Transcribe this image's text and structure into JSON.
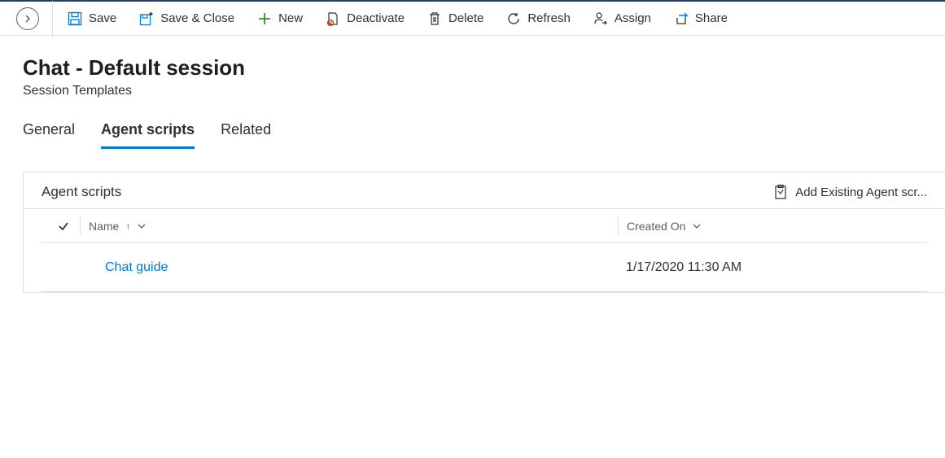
{
  "toolbar": {
    "save_label": "Save",
    "save_close_label": "Save & Close",
    "new_label": "New",
    "deactivate_label": "Deactivate",
    "delete_label": "Delete",
    "refresh_label": "Refresh",
    "assign_label": "Assign",
    "share_label": "Share"
  },
  "header": {
    "title": "Chat - Default session",
    "subtitle": "Session Templates"
  },
  "tabs": [
    {
      "label": "General",
      "active": false
    },
    {
      "label": "Agent scripts",
      "active": true
    },
    {
      "label": "Related",
      "active": false
    }
  ],
  "section": {
    "title": "Agent scripts",
    "add_existing_label": "Add Existing Agent scr..."
  },
  "table": {
    "columns": {
      "name": "Name",
      "created_on": "Created On"
    },
    "rows": [
      {
        "name": "Chat guide",
        "created_on": "1/17/2020 11:30 AM"
      }
    ]
  }
}
